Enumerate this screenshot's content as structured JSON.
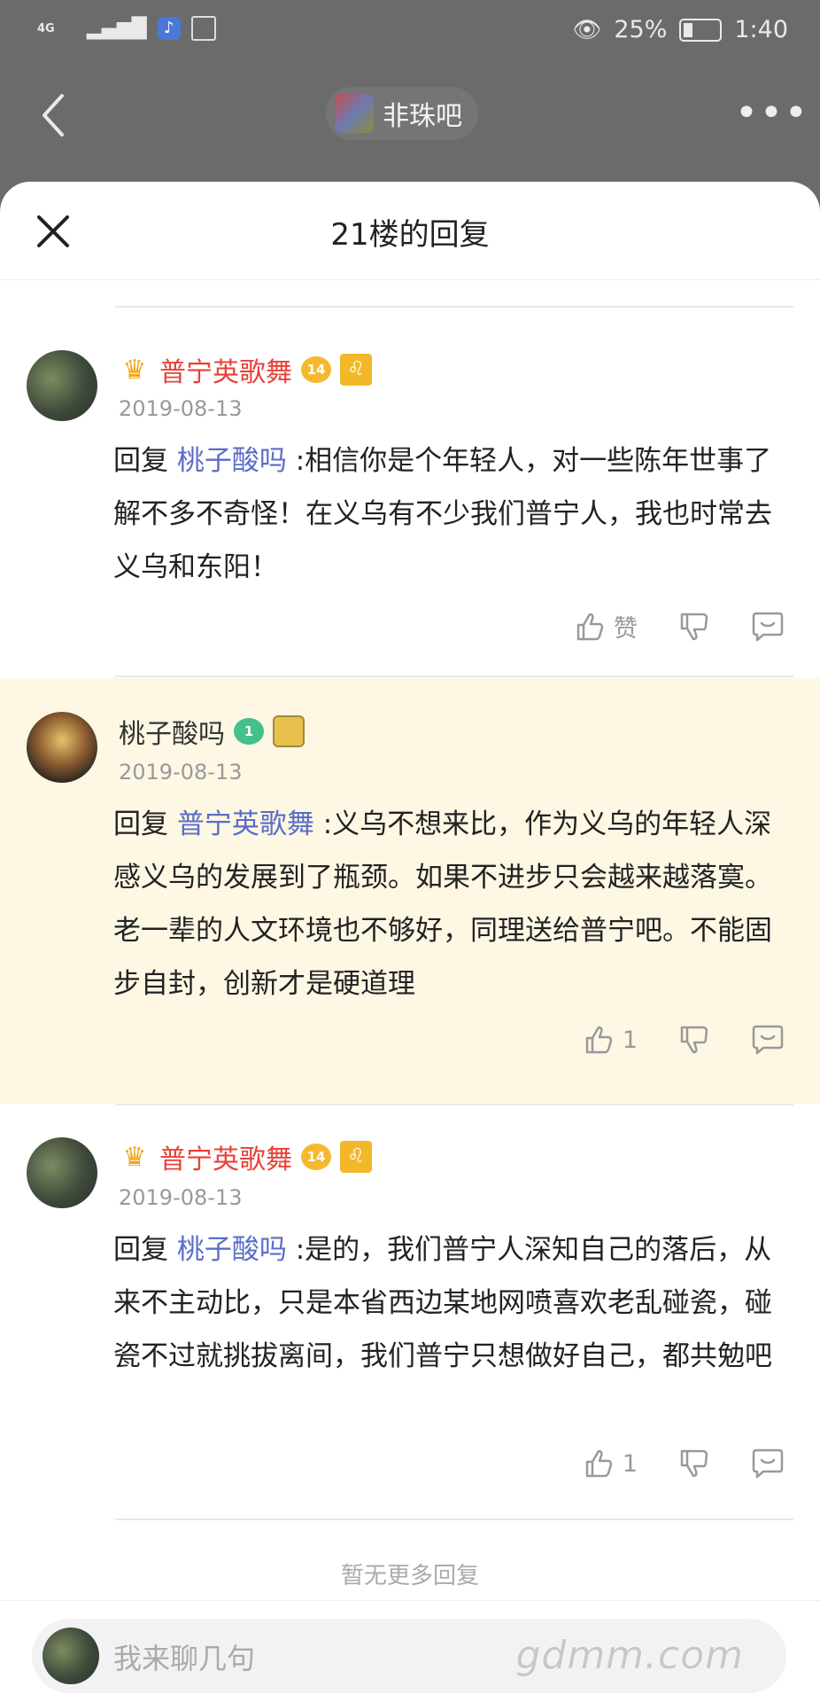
{
  "status_bar": {
    "network": "4G",
    "battery": "25%",
    "time": "1:40"
  },
  "header": {
    "forum_name": "非珠吧"
  },
  "sheet": {
    "title": "21楼的回复"
  },
  "replies": [
    {
      "username": "普宁英歌舞",
      "level": "14",
      "zodiac": "♌",
      "date": "2019-08-13",
      "reply_prefix": "回复 ",
      "mention": "桃子酸吗",
      "text": " :相信你是个年轻人，对一些陈年世事了解不多不奇怪！在义乌有不少我们普宁人，我也时常去义乌和东阳！",
      "like": "赞"
    },
    {
      "username": "桃子酸吗",
      "level": "1",
      "date": "2019-08-13",
      "reply_prefix": "回复 ",
      "mention": "普宁英歌舞",
      "text": " :义乌不想来比，作为义乌的年轻人深感义乌的发展到了瓶颈。如果不进步只会越来越落寞。老一辈的人文环境也不够好，同理送给普宁吧。不能固步自封，创新才是硬道理",
      "like": "1"
    },
    {
      "username": "普宁英歌舞",
      "level": "14",
      "zodiac": "♌",
      "date": "2019-08-13",
      "reply_prefix": "回复 ",
      "mention": "桃子酸吗",
      "text": " :是的，我们普宁人深知自己的落后，从来不主动比，只是本省西边某地网喷喜欢老乱碰瓷，碰瓷不过就挑拔离间，我们普宁只想做好自己，都共勉吧",
      "like": "1"
    }
  ],
  "footer": {
    "no_more": "暂无更多回复",
    "input_placeholder": "我来聊几句",
    "watermark": "gdmm.com"
  }
}
